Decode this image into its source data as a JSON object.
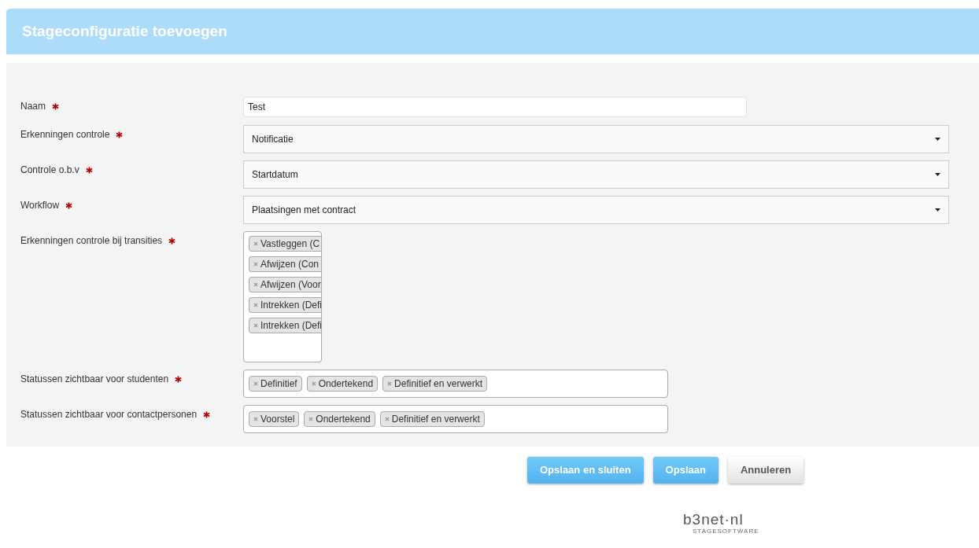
{
  "dialog": {
    "title": "Stageconfiguratie toevoegen"
  },
  "fields": [
    {
      "kind": "text",
      "label": "Naam",
      "required": true,
      "value": "Test"
    },
    {
      "kind": "select",
      "label": "Erkenningen controle",
      "required": true,
      "value": "Notificatie"
    },
    {
      "kind": "select",
      "label": "Controle o.b.v",
      "required": true,
      "value": "Startdatum"
    },
    {
      "kind": "select",
      "label": "Workflow",
      "required": true,
      "value": "Plaatsingen met contract"
    },
    {
      "kind": "stack",
      "label": "Erkenningen controle bij transities",
      "required": true,
      "tags": [
        "Vastleggen (C",
        "Afwijzen (Con",
        "Afwijzen (Voor",
        "Intrekken (Defi",
        "Intrekken (Defi"
      ]
    },
    {
      "kind": "tags",
      "label": "Statussen zichtbaar voor studenten",
      "required": true,
      "tags": [
        "Definitief",
        "Ondertekend",
        "Definitief en verwerkt"
      ]
    },
    {
      "kind": "tags",
      "label": "Statussen zichtbaar voor contactpersonen",
      "required": true,
      "tags": [
        "Voorstel",
        "Ondertekend",
        "Definitief en verwerkt"
      ]
    }
  ],
  "buttons": [
    {
      "label": "Opslaan en sluiten",
      "kind": "primary"
    },
    {
      "label": "Opslaan",
      "kind": "primary"
    },
    {
      "label": "Annuleren",
      "kind": "default"
    }
  ],
  "footer_logo": {
    "wordmark": "b3net·nl",
    "tagline": "STAGESOFTWARE"
  }
}
